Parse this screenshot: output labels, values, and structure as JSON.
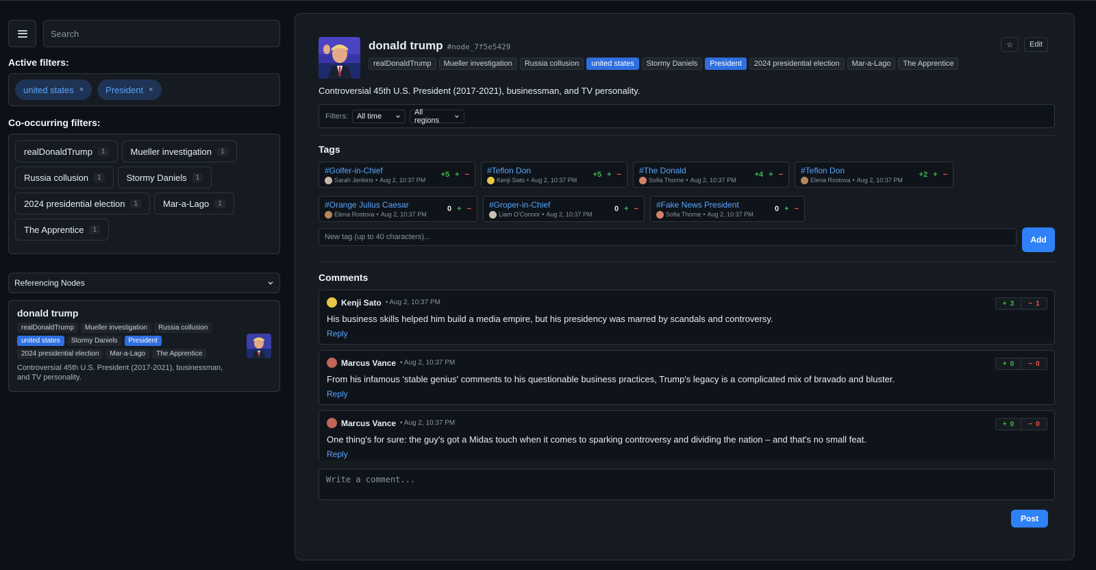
{
  "search": {
    "placeholder": "Search"
  },
  "active_filters": {
    "title": "Active filters:",
    "items": [
      {
        "label": "united states",
        "remove": "×"
      },
      {
        "label": "President",
        "remove": "×"
      }
    ]
  },
  "co_filters": {
    "title": "Co-occurring filters:",
    "items": [
      {
        "label": "realDonaldTrump",
        "count": "1"
      },
      {
        "label": "Mueller investigation",
        "count": "1"
      },
      {
        "label": "Russia collusion",
        "count": "1"
      },
      {
        "label": "Stormy Daniels",
        "count": "1"
      },
      {
        "label": "2024 presidential election",
        "count": "1"
      },
      {
        "label": "Mar-a-Lago",
        "count": "1"
      },
      {
        "label": "The Apprentice",
        "count": "1"
      }
    ]
  },
  "referencing": {
    "select_label": "Referencing Nodes",
    "card": {
      "title": "donald trump",
      "tags": [
        "realDonaldTrump",
        "Mueller investigation",
        "Russia collusion",
        "united states",
        "Stormy Daniels",
        "President",
        "2024 presidential election",
        "Mar-a-Lago",
        "The Apprentice"
      ],
      "highlighted": [
        "united states",
        "President"
      ],
      "description": "Controversial 45th U.S. President (2017-2021), businessman, and TV personality."
    }
  },
  "node": {
    "name": "donald trump",
    "id": "#node_7f5e5429",
    "tags": [
      "realDonaldTrump",
      "Mueller investigation",
      "Russia collusion",
      "united states",
      "Stormy Daniels",
      "President",
      "2024 presidential election",
      "Mar-a-Lago",
      "The Apprentice"
    ],
    "highlighted": [
      "united states",
      "President"
    ],
    "description": "Controversial 45th U.S. President (2017-2021), businessman, and TV personality.",
    "star_label": "☆",
    "edit_label": "Edit"
  },
  "filters": {
    "label": "Filters:",
    "time": "All time",
    "region": "All regions"
  },
  "tags_section": {
    "title": "Tags",
    "rows": [
      [
        {
          "name": "#Golfer-in-Chief",
          "author": "Sarah Jenkins",
          "time": "Aug 2, 10:37 PM",
          "score": "+5",
          "avatar": "#c9b8a8"
        },
        {
          "name": "#Teflon Don",
          "author": "Kenji Sato",
          "time": "Aug 2, 10:37 PM",
          "score": "+5",
          "avatar": "#e8c547"
        },
        {
          "name": "#The Donald",
          "author": "Sofia Thorne",
          "time": "Aug 2, 10:37 PM",
          "score": "+4",
          "avatar": "#d4826a"
        },
        {
          "name": "#Teflon Don",
          "author": "Elena Rostova",
          "time": "Aug 2, 10:37 PM",
          "score": "+2",
          "avatar": "#b8865c"
        }
      ],
      [
        {
          "name": "#Orange Julius Caesar",
          "author": "Elena Rostova",
          "time": "Aug 2, 10:37 PM",
          "score": "0",
          "avatar": "#b8865c"
        },
        {
          "name": "#Groper-in-Chief",
          "author": "Liam O'Connor",
          "time": "Aug 2, 10:37 PM",
          "score": "0",
          "avatar": "#c9c1b8"
        },
        {
          "name": "#Fake News President",
          "author": "Sofia Thorne",
          "time": "Aug 2, 10:37 PM",
          "score": "0",
          "avatar": "#d4826a"
        }
      ]
    ],
    "plus": "+",
    "minus": "−",
    "new_placeholder": "New tag (up to 40 characters)...",
    "add_label": "Add"
  },
  "comments": {
    "title": "Comments",
    "items": [
      {
        "author": "Kenji Sato",
        "time": "• Aug 2, 10:37 PM",
        "text": "His business skills helped him build a media empire, but his presidency was marred by scandals and controversy.",
        "up": "3",
        "down": "1",
        "avatar": "#e8c547",
        "reply": "Reply"
      },
      {
        "author": "Marcus Vance",
        "time": "• Aug 2, 10:37 PM",
        "text": "From his infamous 'stable genius' comments to his questionable business practices, Trump's legacy is a complicated mix of bravado and bluster.",
        "up": "0",
        "down": "0",
        "avatar": "#c2665a",
        "reply": "Reply"
      },
      {
        "author": "Marcus Vance",
        "time": "• Aug 2, 10:37 PM",
        "text": "One thing's for sure: the guy's got a Midas touch when it comes to sparking controversy and dividing the nation – and that's no small feat.",
        "up": "0",
        "down": "0",
        "avatar": "#c2665a",
        "reply": "Reply"
      }
    ],
    "vote_plus": "+",
    "vote_minus": "−",
    "write_placeholder": "Write a comment...",
    "post_label": "Post"
  }
}
